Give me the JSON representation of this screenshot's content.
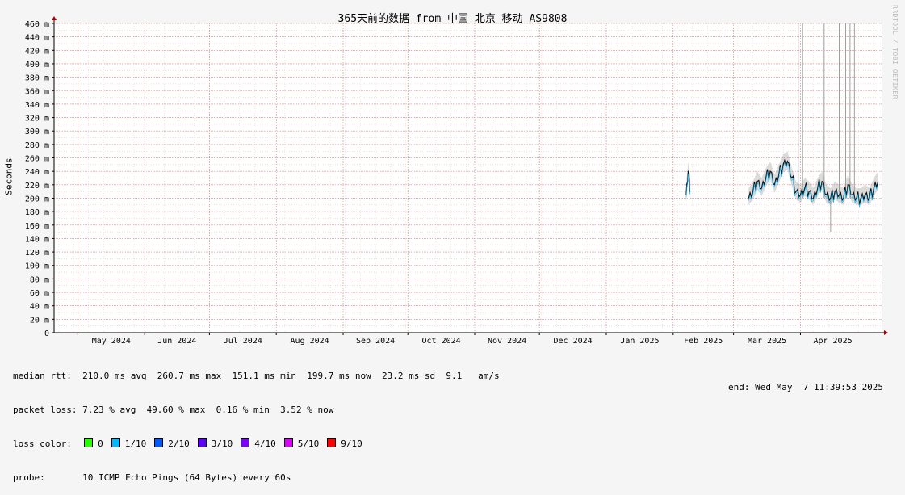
{
  "title": "365天前的数据 from 中国 北京 移动 AS9808",
  "ylabel": "Seconds",
  "watermark": "RRDTOOL / TOBI OETIKER",
  "stats": {
    "median_rtt": "median rtt:  210.0 ms avg  260.7 ms max  151.1 ms min  199.7 ms now  23.2 ms sd  9.1   am/s",
    "packet_loss": "packet loss: 7.23 % avg  49.60 % max  0.16 % min  3.52 % now",
    "loss_color_label": "loss color:",
    "probe": "probe:       10 ICMP Echo Pings (64 Bytes) every 60s",
    "end": "end: Wed May  7 11:39:53 2025"
  },
  "loss_colors": [
    {
      "label": "0",
      "color": "#26ff00"
    },
    {
      "label": "1/10",
      "color": "#00b8ff"
    },
    {
      "label": "2/10",
      "color": "#0059ff"
    },
    {
      "label": "3/10",
      "color": "#5e00ff"
    },
    {
      "label": "4/10",
      "color": "#7e00ff"
    },
    {
      "label": "5/10",
      "color": "#dd00ff"
    },
    {
      "label": "9/10",
      "color": "#ff0000"
    }
  ],
  "chart_data": {
    "type": "line",
    "title": "365天前的数据 from 中国 北京 移动 AS9808",
    "ylabel": "Seconds",
    "ylim": [
      0,
      460
    ],
    "y_ticks": [
      0,
      20,
      40,
      60,
      80,
      100,
      120,
      140,
      160,
      180,
      200,
      220,
      240,
      260,
      280,
      300,
      320,
      340,
      360,
      380,
      400,
      420,
      440,
      460
    ],
    "y_tick_labels": [
      "0",
      "20 m",
      "40 m",
      "60 m",
      "80 m",
      "100 m",
      "120 m",
      "140 m",
      "160 m",
      "180 m",
      "200 m",
      "220 m",
      "240 m",
      "260 m",
      "280 m",
      "300 m",
      "320 m",
      "340 m",
      "360 m",
      "380 m",
      "400 m",
      "420 m",
      "440 m",
      "460 m"
    ],
    "x_tick_labels": [
      "May 2024",
      "Jun 2024",
      "Jul 2024",
      "Aug 2024",
      "Sep 2024",
      "Oct 2024",
      "Nov 2024",
      "Dec 2024",
      "Jan 2025",
      "Feb 2025",
      "Mar 2025",
      "Apr 2025"
    ],
    "grid": true,
    "series": [
      {
        "name": "median rtt",
        "color": "#000000",
        "segments": [
          {
            "x": [
              "2025-02-07",
              "2025-02-08",
              "2025-02-09"
            ],
            "y": [
              205,
              240,
              210
            ]
          },
          {
            "x": [
              "2025-03-08",
              "2025-03-10",
              "2025-03-12",
              "2025-03-14",
              "2025-03-16",
              "2025-03-18",
              "2025-03-20",
              "2025-03-22",
              "2025-03-24",
              "2025-03-26",
              "2025-03-28",
              "2025-03-30",
              "2025-04-01",
              "2025-04-03",
              "2025-04-05",
              "2025-04-07",
              "2025-04-09",
              "2025-04-11",
              "2025-04-13",
              "2025-04-15",
              "2025-04-17",
              "2025-04-19",
              "2025-04-21",
              "2025-04-23",
              "2025-04-25",
              "2025-04-27",
              "2025-04-29",
              "2025-05-01",
              "2025-05-03",
              "2025-05-05",
              "2025-05-07"
            ],
            "y": [
              200,
              210,
              225,
              215,
              230,
              240,
              220,
              235,
              250,
              255,
              230,
              210,
              205,
              215,
              210,
              200,
              215,
              225,
              205,
              200,
              210,
              205,
              200,
              220,
              205,
              200,
              200,
              205,
              200,
              215,
              225
            ]
          }
        ]
      }
    ],
    "spikes": [
      {
        "x": "2025-03-31",
        "y": 460
      },
      {
        "x": "2025-04-02",
        "y": 460
      },
      {
        "x": "2025-04-12",
        "y": 460
      },
      {
        "x": "2025-04-15",
        "y": 150
      },
      {
        "x": "2025-04-19",
        "y": 460
      },
      {
        "x": "2025-04-22",
        "y": 460
      },
      {
        "x": "2025-04-24",
        "y": 460
      },
      {
        "x": "2025-04-26",
        "y": 460
      }
    ]
  }
}
